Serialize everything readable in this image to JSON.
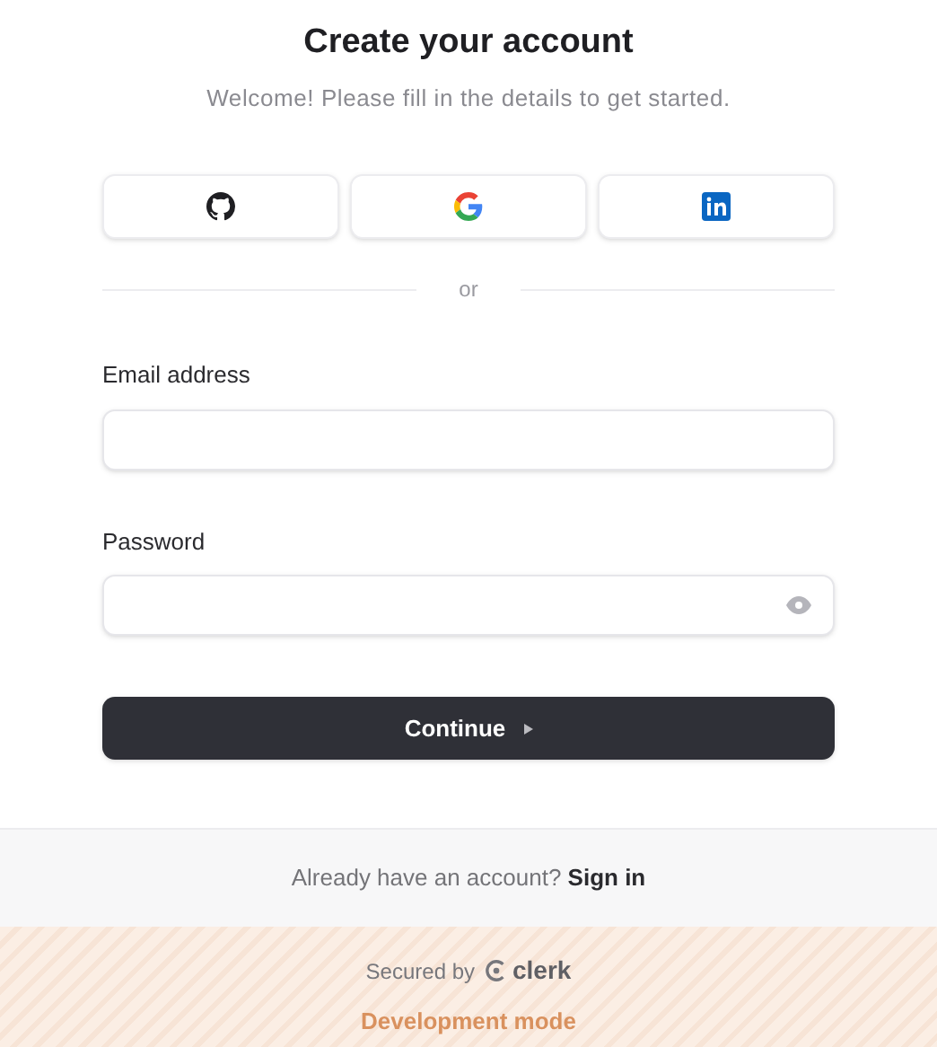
{
  "header": {
    "title": "Create your account",
    "subtitle": "Welcome! Please fill in the details to get started."
  },
  "social_buttons": [
    {
      "kind": "github"
    },
    {
      "kind": "google"
    },
    {
      "kind": "linkedin"
    }
  ],
  "divider": "or",
  "fields": [
    {
      "kind": "text",
      "label": "Email address"
    },
    {
      "kind": "password",
      "label": "Password"
    }
  ],
  "primary_button": "Continue",
  "footer": {
    "prompt": "Already have an account?",
    "link": "Sign in",
    "secured_by": "Secured by",
    "brand": "clerk",
    "mode": "Development mode"
  }
}
